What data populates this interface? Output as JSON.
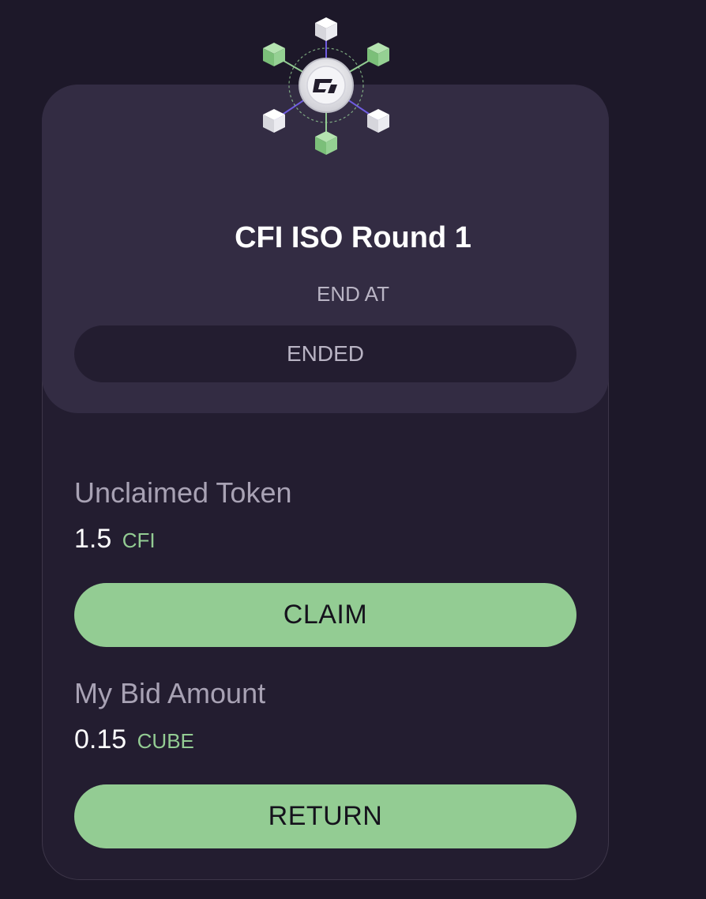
{
  "round": {
    "title": "CFI ISO Round 1",
    "end_label": "END AT",
    "status": "ENDED"
  },
  "unclaimed": {
    "label": "Unclaimed Token",
    "amount": "1.5",
    "unit": "CFI",
    "button_label": "CLAIM"
  },
  "bid": {
    "label": "My Bid Amount",
    "amount": "0.15",
    "unit": "CUBE",
    "button_label": "RETURN"
  },
  "colors": {
    "background": "#1d1829",
    "card": "#231d30",
    "card_top": "#332c43",
    "accent_green": "#93cc93",
    "link_purple": "#6f5ce0"
  },
  "icons": {
    "logo": "cfi-network-logo-icon"
  }
}
